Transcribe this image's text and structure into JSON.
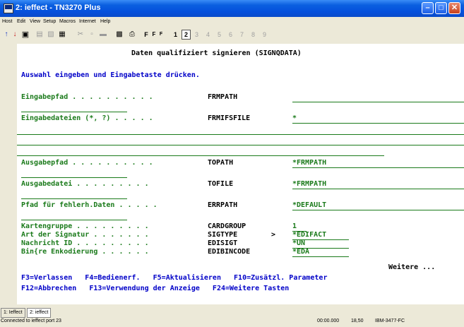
{
  "window": {
    "title": "2: ieffect - TN3270 Plus"
  },
  "menu": [
    "Host",
    "Edit",
    "View",
    "Setup",
    "Macros",
    "Internet",
    "Help"
  ],
  "toolbar": {
    "sessions": [
      "1",
      "2",
      "3",
      "4",
      "5",
      "6",
      "7",
      "8",
      "9"
    ],
    "active_session": "2",
    "font_buttons": [
      "F",
      "F",
      "F"
    ]
  },
  "screen": {
    "title": "Daten qualifiziert signieren (SIGNQDATA)",
    "instruction": "Auswahl eingeben und Eingabetaste drücken.",
    "fields": [
      {
        "label": "Eingabepfad . . . . . . . . . .",
        "keyword": "FRMPATH",
        "value": ""
      },
      {
        "label": "Eingabedateien (*, ?) . . . . .",
        "keyword": "FRMIFSFILE",
        "value": "*"
      },
      {
        "label": "Ausgabepfad . . . . . . . . . .",
        "keyword": "TOPATH",
        "value": "*FRMPATH"
      },
      {
        "label": "Ausgabedatei . . . . . . . . .",
        "keyword": "TOFILE",
        "value": "*FRMPATH"
      },
      {
        "label": "Pfad für fehlerh.Daten . . . . .",
        "keyword": "ERRPATH",
        "value": "*DEFAULT"
      },
      {
        "label": "Kartengruppe . . . . . . . . .",
        "keyword": "CARDGROUP",
        "value": "1"
      },
      {
        "label": "Art der Signatur . . . . . . .",
        "keyword": "SIGTYPE",
        "value": "*EDIFACT",
        "prompt": ">"
      },
      {
        "label": "Nachricht ID . . . . . . . . .",
        "keyword": "EDISIGT",
        "value": "*UN"
      },
      {
        "label": "Bin{re Enkodierung . . . . . .",
        "keyword": "EDIBINCODE",
        "value": "*EDA"
      }
    ],
    "more": "Weitere ...",
    "fkeys_line1": "F3=Verlassen   F4=Bedienerf.   F5=Aktualisieren   F10=Zusätzl. Parameter",
    "fkeys_line2": "F12=Abbrechen   F13=Verwendung der Anzeige   F24=Weitere Tasten"
  },
  "tabs": [
    "1: Ieffect",
    "2: ieffect"
  ],
  "status": {
    "left": "Connected to ieffect port 23",
    "time": "00:00.000",
    "cursor": "18,50",
    "terminal": "IBM-3477-FC"
  }
}
